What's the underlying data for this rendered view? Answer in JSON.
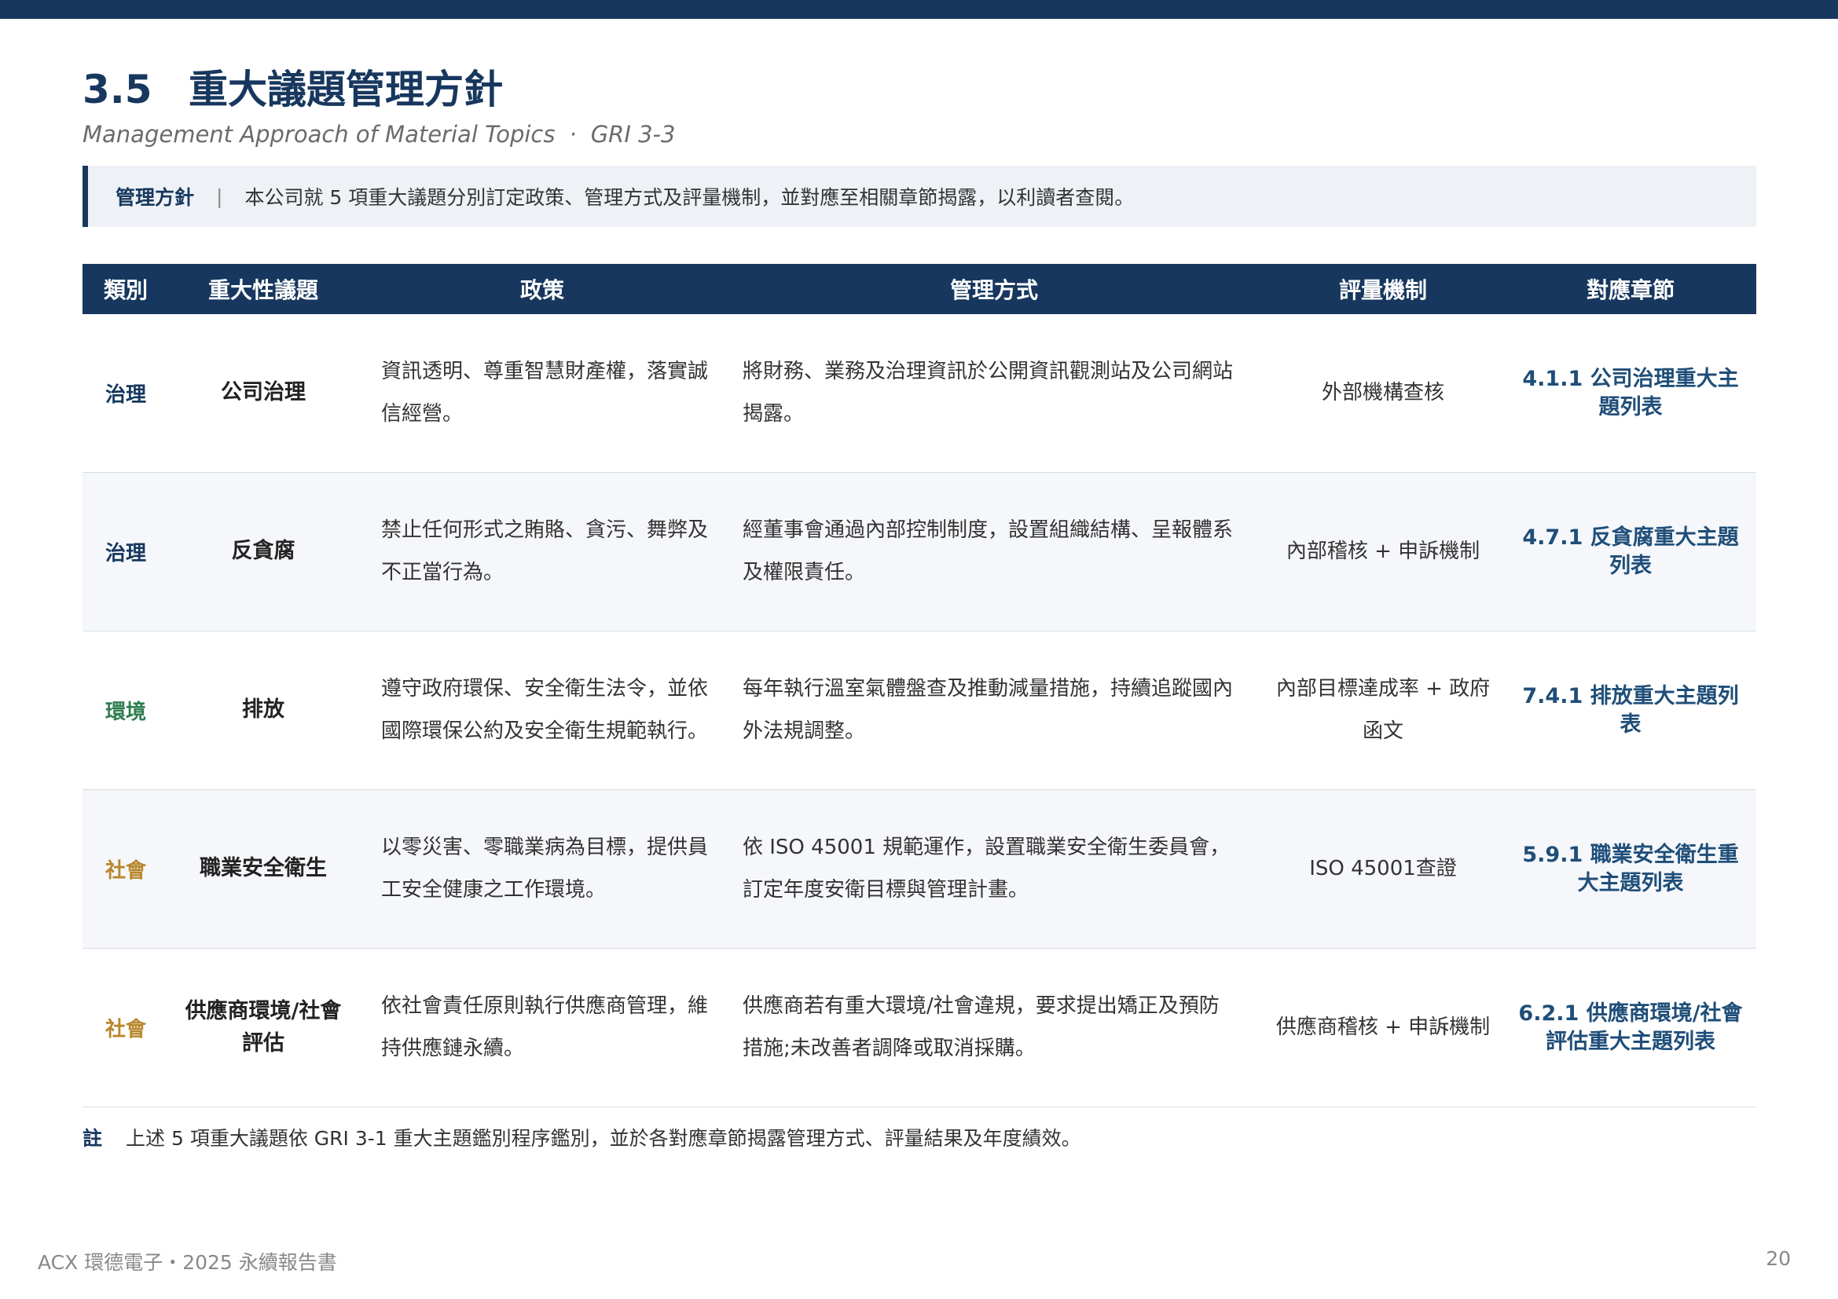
{
  "section": {
    "number": "3.5",
    "title": "重大議題管理方針",
    "subtitle": "Management Approach of Material Topics",
    "subtitle_sep": "·",
    "gri": "GRI 3-3"
  },
  "approach": {
    "label": "管理方針",
    "divider": "|",
    "text": "本公司就 5 項重大議題分別訂定政策、管理方式及評量機制，並對應至相關章節揭露，以利讀者查閱。"
  },
  "table": {
    "headers": [
      "類別",
      "重大性議題",
      "政策",
      "管理方式",
      "評量機制",
      "對應章節"
    ],
    "rows": [
      {
        "category": "治理",
        "topic": "公司治理",
        "policy": "資訊透明、尊重智慧財產權，落實誠信經營。",
        "management": "將財務、業務及治理資訊於公開資訊觀測站及公司網站揭露。",
        "evaluation": "外部機構查核",
        "chapter": "4.1.1 公司治理重大主題列表"
      },
      {
        "category": "治理",
        "topic": "反貪腐",
        "policy": "禁止任何形式之賄賂、貪污、舞弊及不正當行為。",
        "management": "經董事會通過內部控制制度，設置組織結構、呈報體系及權限責任。",
        "evaluation": "內部稽核 + 申訴機制",
        "chapter": "4.7.1 反貪腐重大主題列表"
      },
      {
        "category": "環境",
        "topic": "排放",
        "policy": "遵守政府環保、安全衛生法令，並依國際環保公約及安全衛生規範執行。",
        "management": "每年執行溫室氣體盤查及推動減量措施，持續追蹤國內外法規調整。",
        "evaluation": "內部目標達成率 + 政府函文",
        "chapter": "7.4.1 排放重大主題列表"
      },
      {
        "category": "社會",
        "topic": "職業安全衛生",
        "policy": "以零災害、零職業病為目標，提供員工安全健康之工作環境。",
        "management": "依 ISO 45001 規範運作，設置職業安全衛生委員會，訂定年度安衛目標與管理計畫。",
        "evaluation": "ISO 45001查證",
        "chapter": "5.9.1 職業安全衛生重大主題列表"
      },
      {
        "category": "社會",
        "topic": "供應商環境/社會評估",
        "policy": "依社會責任原則執行供應商管理，維持供應鏈永續。",
        "management": "供應商若有重大環境/社會違規，要求提出矯正及預防措施;未改善者調降或取消採購。",
        "evaluation": "供應商稽核 + 申訴機制",
        "chapter": "6.2.1 供應商環境/社會評估重大主題列表"
      }
    ]
  },
  "note": {
    "mark": "註",
    "text": "上述 5 項重大議題依 GRI 3-1 重大主題鑑別程序鑑別，並於各對應章節揭露管理方式、評量結果及年度績效。"
  },
  "footer": {
    "report": "ACX 環德電子・2025 永續報告書",
    "page": "20"
  },
  "colors": {
    "primary": "#17375e",
    "governance": "#17375e",
    "environment": "#2e7d4f",
    "social": "#b7862a",
    "chapter_link": "#1f4e79"
  }
}
